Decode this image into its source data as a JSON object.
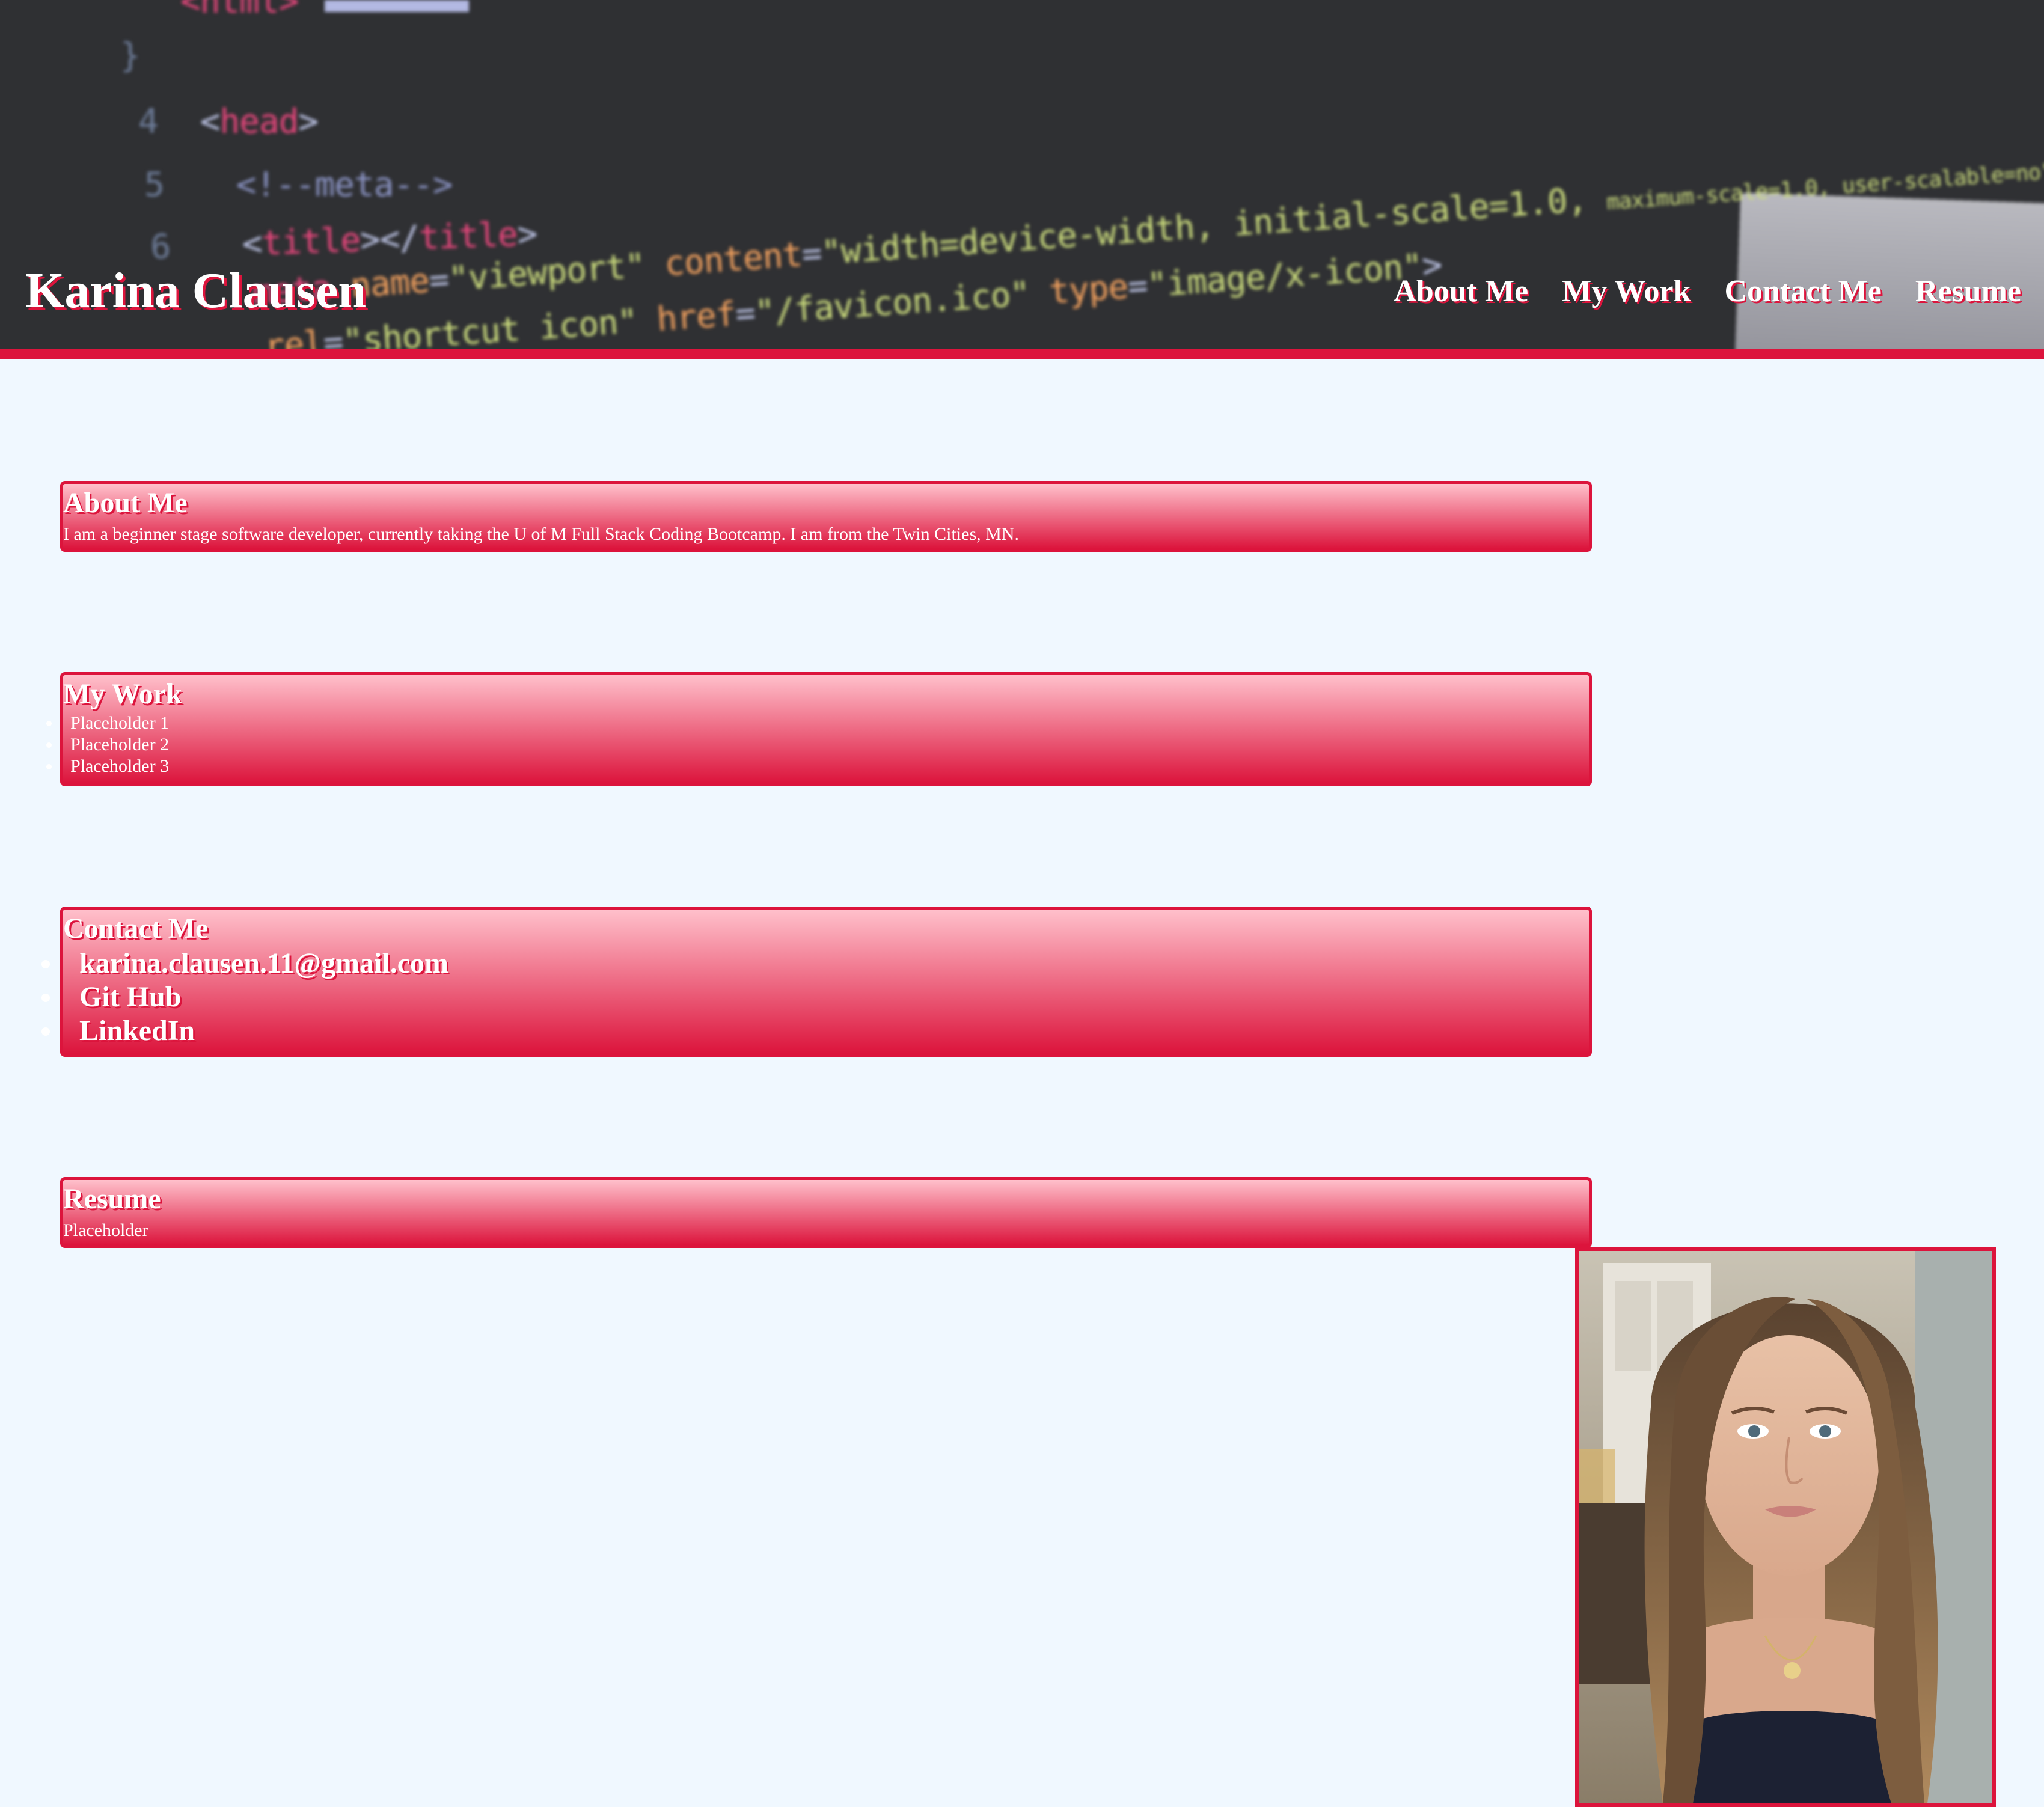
{
  "header": {
    "site_title": "Karina Clausen",
    "nav": [
      {
        "label": "About Me"
      },
      {
        "label": "My Work"
      },
      {
        "label": "Contact Me"
      },
      {
        "label": "Resume"
      }
    ],
    "background_code": [
      {
        "line_no": "",
        "text": "<html>"
      },
      {
        "line_no": "",
        "text": "<head>"
      },
      {
        "line_no": "",
        "text": "<!--meta-->"
      },
      {
        "line_no": "",
        "text": "<title></title>"
      },
      {
        "line_no": "",
        "text": "<meta name=\"viewport\" content=\"width=device-width, initial-scale=1.0, maximum-scale=1.0, user-scalable=no\" />"
      },
      {
        "line_no": "",
        "text": "<link rel=\"shortcut icon\" href=\"/favicon.ico\" type=\"image/x-icon\">"
      }
    ]
  },
  "sections": {
    "about": {
      "title": "About Me",
      "body": "I am a beginner stage software developer, currently taking the U of M Full Stack Coding Bootcamp. I am from the Twin Cities, MN."
    },
    "work": {
      "title": "My Work",
      "items": [
        "Placeholder 1",
        "Placeholder 2",
        "Placeholder 3"
      ]
    },
    "contact": {
      "title": "Contact Me",
      "items": [
        "karina.clausen.11@gmail.com",
        "Git Hub",
        "LinkedIn"
      ]
    },
    "resume": {
      "title": "Resume",
      "body": "Placeholder"
    }
  },
  "colors": {
    "accent": "#dc143c",
    "gradient_top": "#ffc0cb",
    "page_bg": "#f0f8ff",
    "header_bg": "#2f3033"
  },
  "photo": {
    "icon": "profile-photo"
  }
}
